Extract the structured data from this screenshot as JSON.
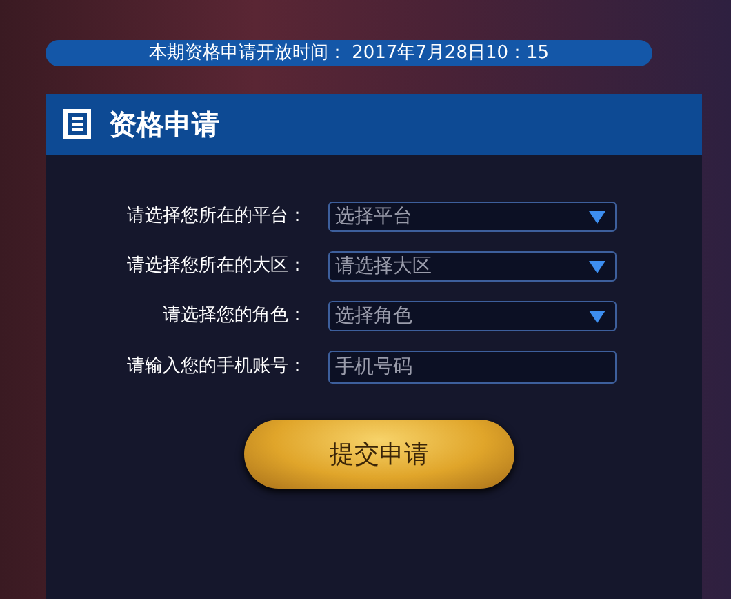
{
  "banner": {
    "text": "本期资格申请开放时间： 2017年7月28日10：15"
  },
  "panel": {
    "title": "资格申请"
  },
  "fields": [
    {
      "kind": "select",
      "label": "请选择您所在的平台：",
      "placeholder": "选择平台"
    },
    {
      "kind": "select",
      "label": "请选择您所在的大区：",
      "placeholder": "请选择大区"
    },
    {
      "kind": "select",
      "label": "请选择您的角色：",
      "placeholder": "选择角色"
    },
    {
      "kind": "input",
      "label": "请输入您的手机账号：",
      "placeholder": "手机号码"
    }
  ],
  "submit_button": "提交申请"
}
